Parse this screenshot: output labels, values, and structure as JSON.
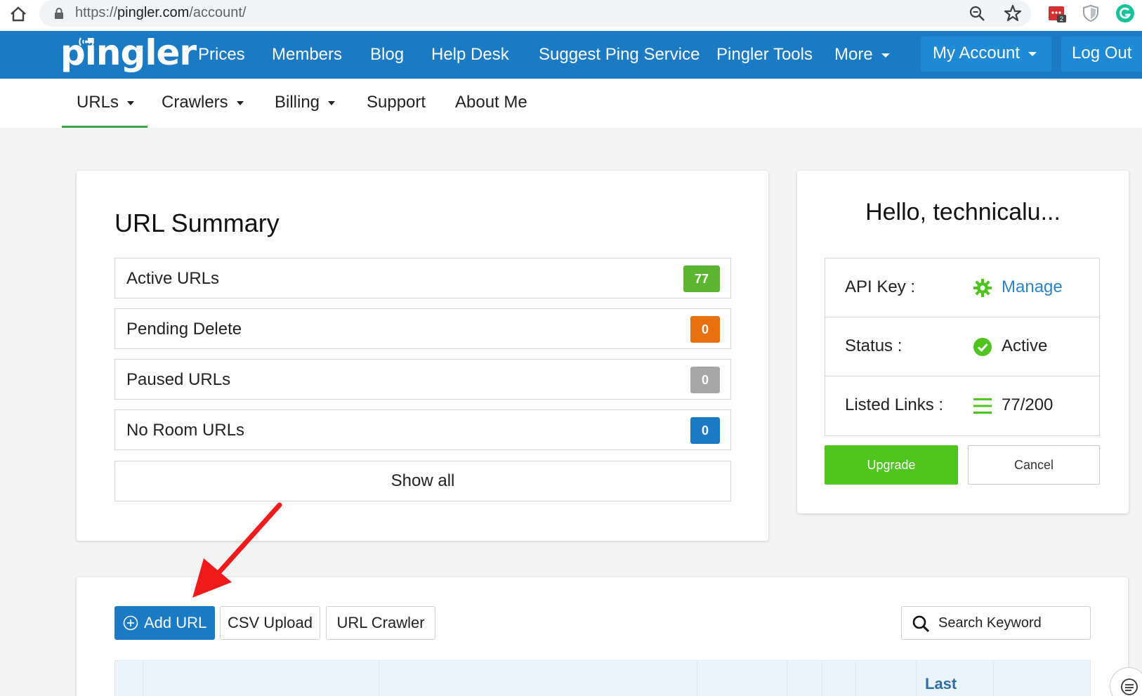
{
  "browser": {
    "url_scheme": "https://",
    "url_host": "pingler.com",
    "url_path": "/account/",
    "extension_badge": "2"
  },
  "topnav": {
    "logo": "pingler",
    "items": [
      "Prices",
      "Members",
      "Blog",
      "Help Desk",
      "Suggest Ping Service",
      "Pingler Tools",
      "More"
    ],
    "my_account": "My Account",
    "logout": "Log Out"
  },
  "subnav": {
    "items": [
      "URLs",
      "Crawlers",
      "Billing",
      "Support",
      "About Me"
    ]
  },
  "summary": {
    "title": "URL Summary",
    "rows": [
      {
        "label": "Active URLs",
        "count": "77",
        "color": "#5cb531"
      },
      {
        "label": "Pending Delete",
        "count": "0",
        "color": "#e8710f"
      },
      {
        "label": "Paused URLs",
        "count": "0",
        "color": "#a6a6a6"
      },
      {
        "label": "No Room URLs",
        "count": "0",
        "color": "#1a7bc4"
      }
    ],
    "show_all": "Show all"
  },
  "account": {
    "greeting": "Hello, technicalu...",
    "api_key_label": "API Key :",
    "api_key_value": "Manage",
    "status_label": "Status :",
    "status_value": "Active",
    "links_label": "Listed Links :",
    "links_value": "77/200",
    "upgrade": "Upgrade",
    "cancel": "Cancel"
  },
  "urls_panel": {
    "add_url": "Add URL",
    "csv_upload": "CSV Upload",
    "url_crawler": "URL Crawler",
    "search_placeholder": "Search Keyword",
    "table_header_last": "Last"
  },
  "colors": {
    "brand_blue": "#1a7bc4",
    "green": "#4fc31e",
    "link": "#2f83c3"
  }
}
